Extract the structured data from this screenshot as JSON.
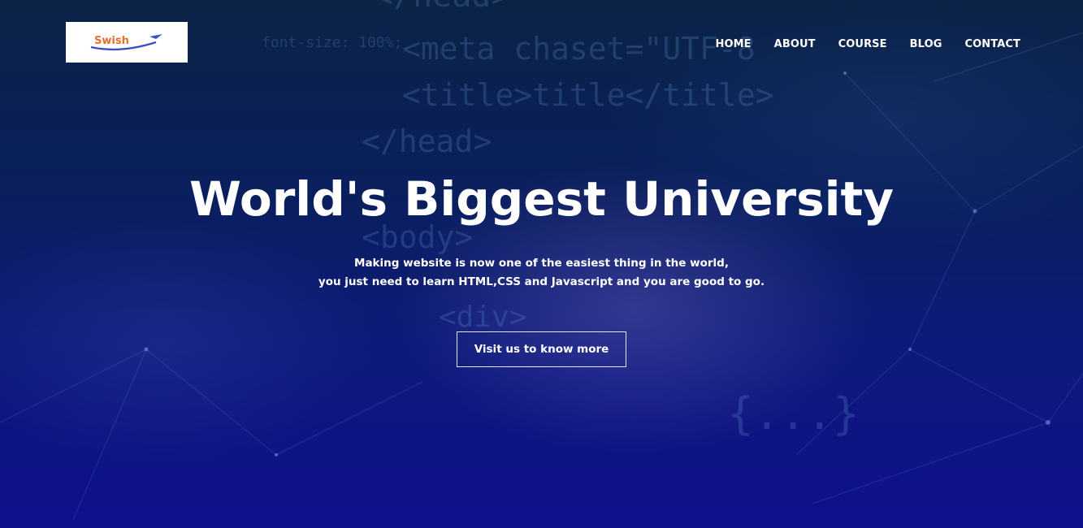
{
  "brand": {
    "logo_text": "Swish"
  },
  "nav": {
    "items": [
      {
        "label": "HOME"
      },
      {
        "label": "ABOUT"
      },
      {
        "label": "COURSE"
      },
      {
        "label": "BLOG"
      },
      {
        "label": "CONTACT"
      }
    ]
  },
  "hero": {
    "title": "World's Biggest University",
    "subtitle_line1": "Making website is now one of the easiest thing in the world,",
    "subtitle_line2": "you just need to learn HTML,CSS and Javascript and you are good to go.",
    "cta_label": "Visit us to know more"
  },
  "background_code": {
    "line1": "</head>",
    "line2": "<meta chaset=\"UTF-8",
    "line3": "<title>title</title>",
    "line4": "</head>",
    "line5": "<body>",
    "line6": "font-size: 100%;",
    "line7": "<div>",
    "line8": "{...}"
  },
  "colors": {
    "background_top": "#0b2346",
    "background_bottom": "#0f0f8c",
    "text": "#ffffff",
    "logo_orange": "#e8702a",
    "logo_blue": "#3a4fc4"
  }
}
